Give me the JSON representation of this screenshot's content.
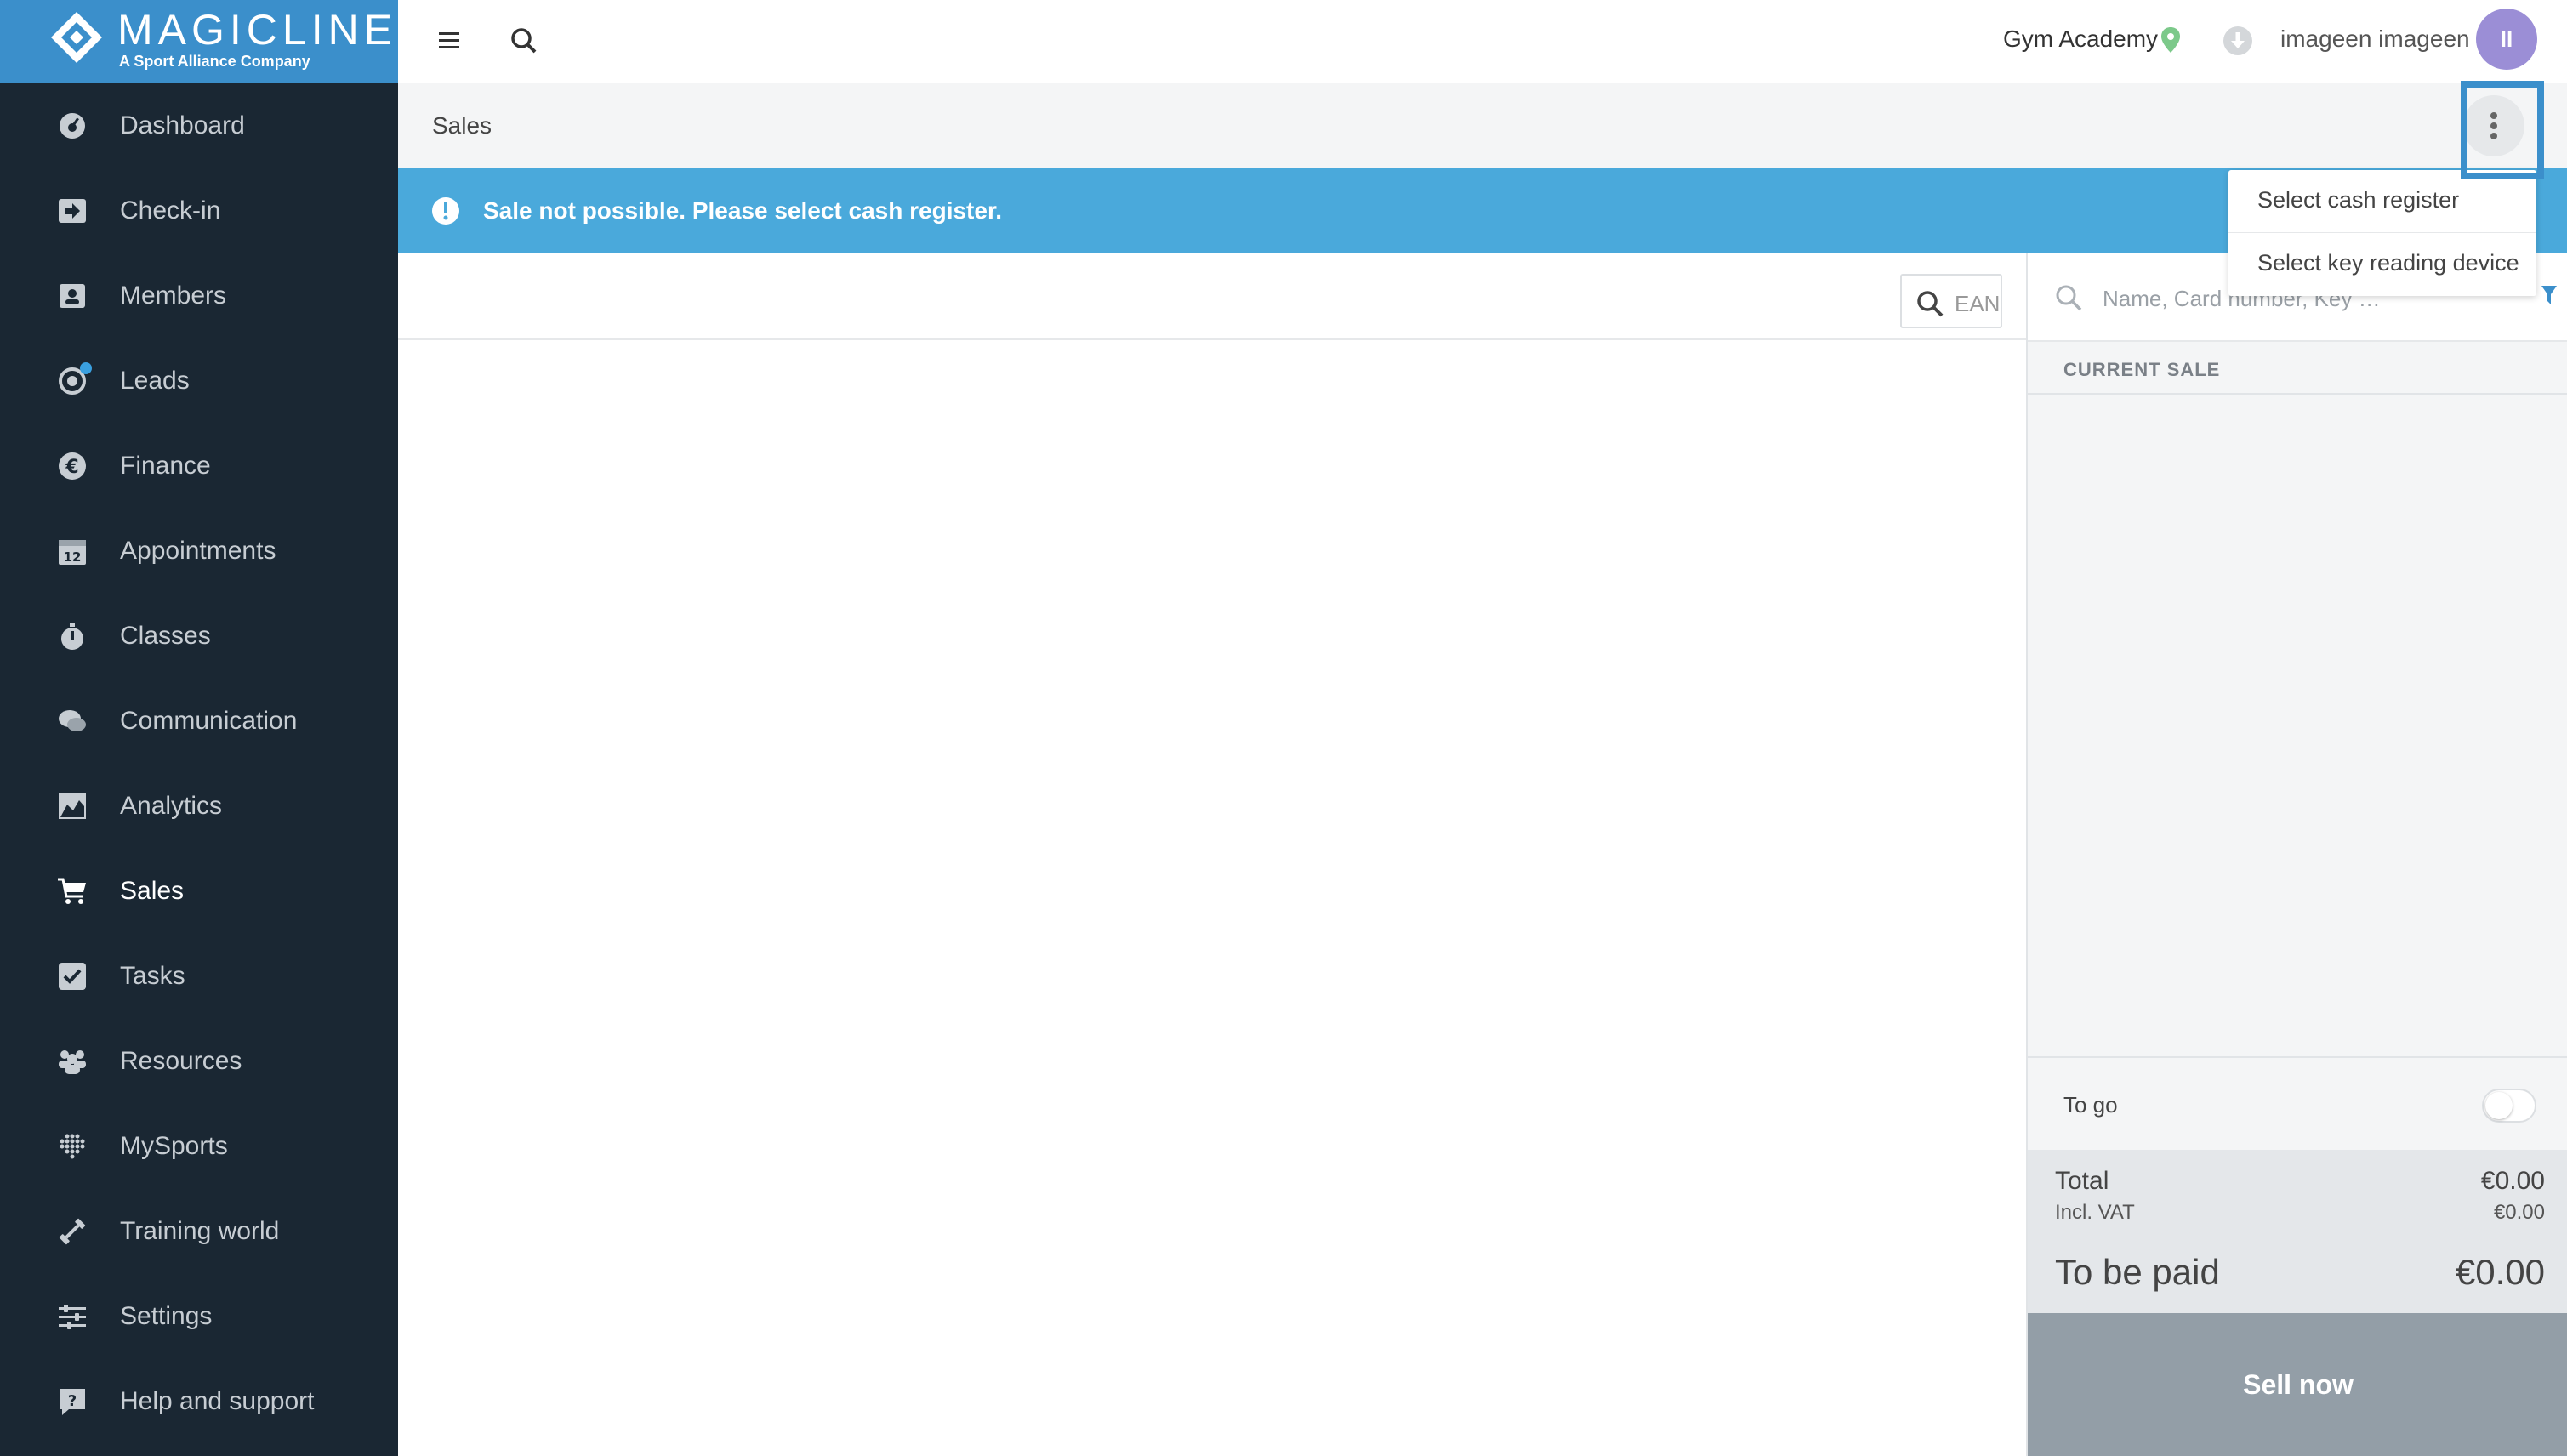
{
  "brand": {
    "name": "MAGICLINE",
    "tagline": "A Sport Alliance Company"
  },
  "sidebar": {
    "items": [
      {
        "label": "Dashboard",
        "icon": "dashboard-icon"
      },
      {
        "label": "Check-in",
        "icon": "check-in-icon"
      },
      {
        "label": "Members",
        "icon": "members-icon"
      },
      {
        "label": "Leads",
        "icon": "leads-icon"
      },
      {
        "label": "Finance",
        "icon": "euro-icon"
      },
      {
        "label": "Appointments",
        "icon": "calendar-icon"
      },
      {
        "label": "Classes",
        "icon": "stopwatch-icon"
      },
      {
        "label": "Communication",
        "icon": "chat-icon"
      },
      {
        "label": "Analytics",
        "icon": "chart-icon"
      },
      {
        "label": "Sales",
        "icon": "cart-icon"
      },
      {
        "label": "Tasks",
        "icon": "checkbox-icon"
      },
      {
        "label": "Resources",
        "icon": "people-icon"
      },
      {
        "label": "MySports",
        "icon": "dots-grid-icon"
      },
      {
        "label": "Training world",
        "icon": "dumbbell-icon"
      },
      {
        "label": "Settings",
        "icon": "sliders-icon"
      },
      {
        "label": "Help and support",
        "icon": "help-icon"
      }
    ],
    "active": "Sales"
  },
  "topbar": {
    "gym": "Gym Academy",
    "user": "imageen imageen",
    "avatar_initials": "II"
  },
  "page": {
    "title": "Sales"
  },
  "alert": {
    "message": "Sale not possible. Please select cash register."
  },
  "dropdown": {
    "items": [
      "Select cash register",
      "Select key reading device"
    ]
  },
  "left": {
    "ean_placeholder": "EAN"
  },
  "right": {
    "search_placeholder": "Name, Card number, Key …",
    "current_sale": "CURRENT SALE",
    "to_go": "To go",
    "total_label": "Total",
    "total_value": "€0.00",
    "vat_label": "Incl. VAT",
    "vat_value": "€0.00",
    "to_be_paid_label": "To be paid",
    "to_be_paid_value": "€0.00",
    "sell_now": "Sell now"
  },
  "colors": {
    "sidebar": "#1a2733",
    "brand": "#3b8fcb",
    "alert": "#4aa9db",
    "avatar": "#9b8ed6",
    "sell_button": "#939ea7"
  }
}
